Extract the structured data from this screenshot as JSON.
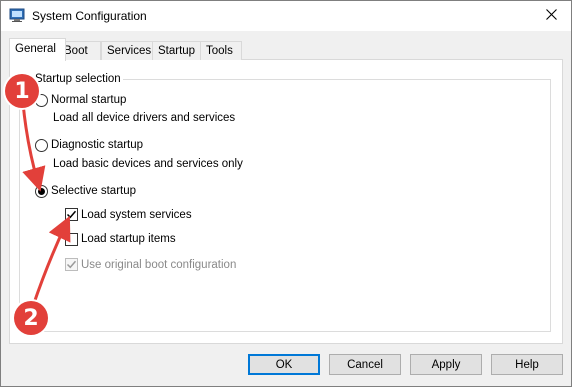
{
  "window": {
    "title": "System Configuration",
    "close_icon": "close-icon"
  },
  "tabs": [
    {
      "label": "General",
      "active": true
    },
    {
      "label": "Boot",
      "active": false
    },
    {
      "label": "Services",
      "active": false
    },
    {
      "label": "Startup",
      "active": false
    },
    {
      "label": "Tools",
      "active": false
    }
  ],
  "startup_selection": {
    "legend": "Startup selection",
    "normal": {
      "label": "Normal startup",
      "description": "Load all device drivers and services",
      "selected": false
    },
    "diagnostic": {
      "label": "Diagnostic startup",
      "description": "Load basic devices and services only",
      "selected": false
    },
    "selective": {
      "label": "Selective startup",
      "selected": true
    },
    "options": [
      {
        "label": "Load system services",
        "checked": true,
        "enabled": true
      },
      {
        "label": "Load startup items",
        "checked": false,
        "enabled": true
      },
      {
        "label": "Use original boot configuration",
        "checked": true,
        "enabled": false
      }
    ]
  },
  "buttons": {
    "ok": "OK",
    "cancel": "Cancel",
    "apply": "Apply",
    "help": "Help"
  },
  "annotations": {
    "marker_1": "1",
    "marker_2": "2",
    "color": "#e2403a"
  }
}
